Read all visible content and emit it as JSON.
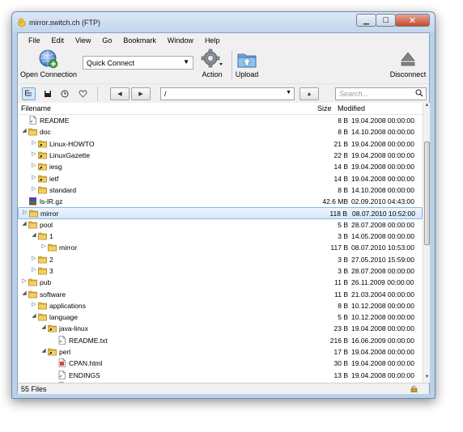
{
  "window": {
    "title": "mirror.switch.ch (FTP)"
  },
  "menu": [
    "File",
    "Edit",
    "View",
    "Go",
    "Bookmark",
    "Window",
    "Help"
  ],
  "toolbar": {
    "open_connection": "Open Connection",
    "quick_connect": "Quick Connect",
    "action": "Action",
    "upload": "Upload",
    "disconnect": "Disconnect"
  },
  "nav": {
    "path": "/",
    "search_placeholder": "Search..."
  },
  "columns": {
    "filename": "Filename",
    "size": "Size",
    "modified": "Modified"
  },
  "rows": [
    {
      "depth": 0,
      "twisty": "",
      "type": "file",
      "name": "README",
      "size": "8 B",
      "modified": "19.04.2008 00:00:00"
    },
    {
      "depth": 0,
      "twisty": "open",
      "type": "folder",
      "name": "doc",
      "size": "8 B",
      "modified": "14.10.2008 00:00:00"
    },
    {
      "depth": 1,
      "twisty": "closed",
      "type": "folder-link",
      "name": "Linux-HOWTO",
      "size": "21 B",
      "modified": "19.04.2008 00:00:00"
    },
    {
      "depth": 1,
      "twisty": "closed",
      "type": "folder-link",
      "name": "LinuxGazette",
      "size": "22 B",
      "modified": "19.04.2008 00:00:00"
    },
    {
      "depth": 1,
      "twisty": "closed",
      "type": "folder-link",
      "name": "iesg",
      "size": "14 B",
      "modified": "19.04.2008 00:00:00"
    },
    {
      "depth": 1,
      "twisty": "closed",
      "type": "folder-link",
      "name": "ietf",
      "size": "14 B",
      "modified": "19.04.2008 00:00:00"
    },
    {
      "depth": 1,
      "twisty": "closed",
      "type": "folder",
      "name": "standard",
      "size": "8 B",
      "modified": "14.10.2008 00:00:00"
    },
    {
      "depth": 0,
      "twisty": "",
      "type": "archive",
      "name": "ls-lR.gz",
      "size": "42.6 MB",
      "modified": "02.09.2010 04:43:00"
    },
    {
      "depth": 0,
      "twisty": "closed",
      "type": "folder",
      "name": "mirror",
      "size": "118 B",
      "modified": "08.07.2010 10:52:00",
      "selected": true
    },
    {
      "depth": 0,
      "twisty": "open",
      "type": "folder",
      "name": "pool",
      "size": "5 B",
      "modified": "28.07.2008 00:00:00"
    },
    {
      "depth": 1,
      "twisty": "open",
      "type": "folder",
      "name": "1",
      "size": "3 B",
      "modified": "14.05.2008 00:00:00"
    },
    {
      "depth": 2,
      "twisty": "closed",
      "type": "folder",
      "name": "mirror",
      "size": "117 B",
      "modified": "08.07.2010 10:53:00"
    },
    {
      "depth": 1,
      "twisty": "closed",
      "type": "folder",
      "name": "2",
      "size": "3 B",
      "modified": "27.05.2010 15:59:00"
    },
    {
      "depth": 1,
      "twisty": "closed",
      "type": "folder",
      "name": "3",
      "size": "3 B",
      "modified": "28.07.2008 00:00:00"
    },
    {
      "depth": 0,
      "twisty": "closed",
      "type": "folder",
      "name": "pub",
      "size": "11 B",
      "modified": "26.11.2009 00:00:00"
    },
    {
      "depth": 0,
      "twisty": "open",
      "type": "folder",
      "name": "software",
      "size": "11 B",
      "modified": "21.03.2004 00:00:00"
    },
    {
      "depth": 1,
      "twisty": "closed",
      "type": "folder",
      "name": "applications",
      "size": "8 B",
      "modified": "10.12.2008 00:00:00"
    },
    {
      "depth": 1,
      "twisty": "open",
      "type": "folder",
      "name": "language",
      "size": "5 B",
      "modified": "10.12.2008 00:00:00"
    },
    {
      "depth": 2,
      "twisty": "open",
      "type": "folder-link",
      "name": "java-linux",
      "size": "23 B",
      "modified": "19.04.2008 00:00:00"
    },
    {
      "depth": 3,
      "twisty": "",
      "type": "file",
      "name": "README.txt",
      "size": "216 B",
      "modified": "16.06.2009 00:00:00"
    },
    {
      "depth": 2,
      "twisty": "open",
      "type": "folder-link",
      "name": "perl",
      "size": "17 B",
      "modified": "19.04.2008 00:00:00"
    },
    {
      "depth": 3,
      "twisty": "",
      "type": "file-html",
      "name": "CPAN.html",
      "size": "30 B",
      "modified": "19.04.2008 00:00:00"
    },
    {
      "depth": 3,
      "twisty": "",
      "type": "file",
      "name": "ENDINGS",
      "size": "13 B",
      "modified": "19.04.2008 00:00:00"
    },
    {
      "depth": 3,
      "twisty": "",
      "type": "file",
      "name": "MIRRORED.BY",
      "size": "",
      "modified": ""
    }
  ],
  "status": {
    "text": "55 Files"
  },
  "colors": {
    "selection": "#d6e8fb",
    "folder": "#e2b43c",
    "titlebar": "#c3d6ec"
  }
}
